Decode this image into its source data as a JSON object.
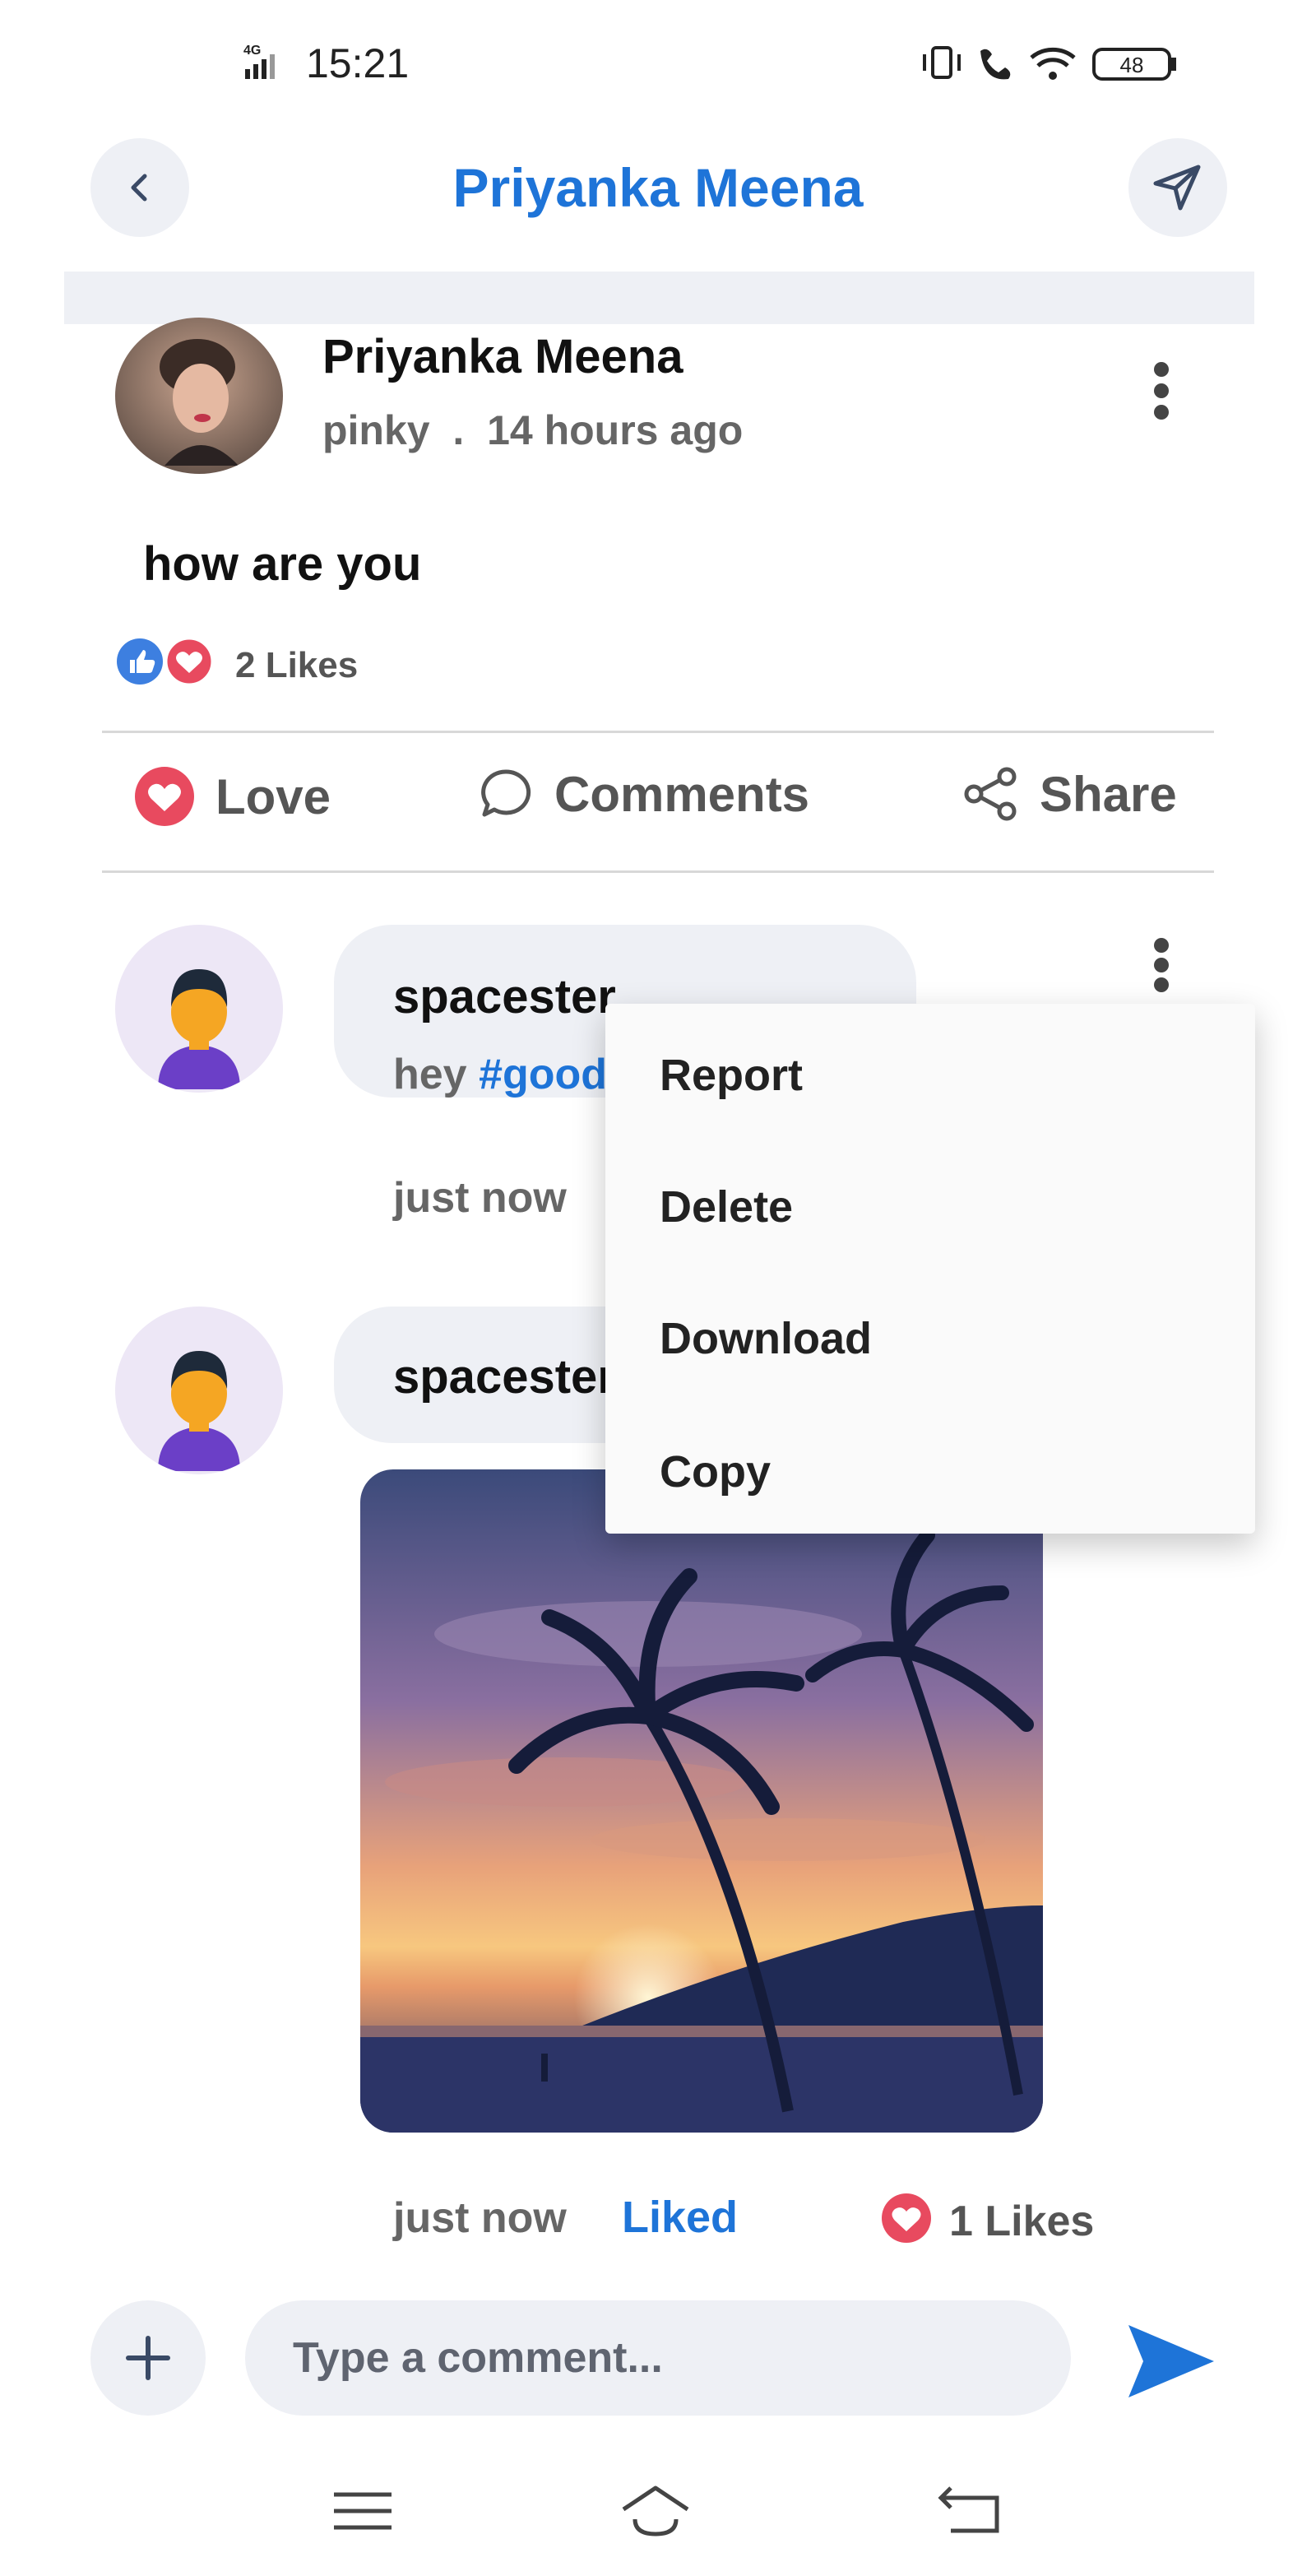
{
  "status_bar": {
    "network": "4G",
    "time": "15:21",
    "battery": "48"
  },
  "header": {
    "title": "Priyanka Meena",
    "back_icon": "chevron-left-icon",
    "send_icon": "paper-plane-icon"
  },
  "post": {
    "author": "Priyanka Meena",
    "username": "pinky",
    "separator": ".",
    "time": "14 hours ago",
    "text": "how are you",
    "likes": "2 Likes"
  },
  "actions": {
    "love": "Love",
    "comments": "Comments",
    "share": "Share"
  },
  "comments": [
    {
      "name": "spacester",
      "text_plain": "hey ",
      "hashtag": "#good",
      "time": "just now"
    },
    {
      "name": "spacester",
      "time": "just now",
      "liked_label": "Liked",
      "likes": "1 Likes"
    }
  ],
  "context_menu": {
    "items": [
      "Report",
      "Delete",
      "Download",
      "Copy"
    ]
  },
  "composer": {
    "placeholder": "Type a comment..."
  },
  "colors": {
    "accent": "#1e74d8",
    "love": "#e84a5f",
    "surface": "#eef0f5"
  }
}
